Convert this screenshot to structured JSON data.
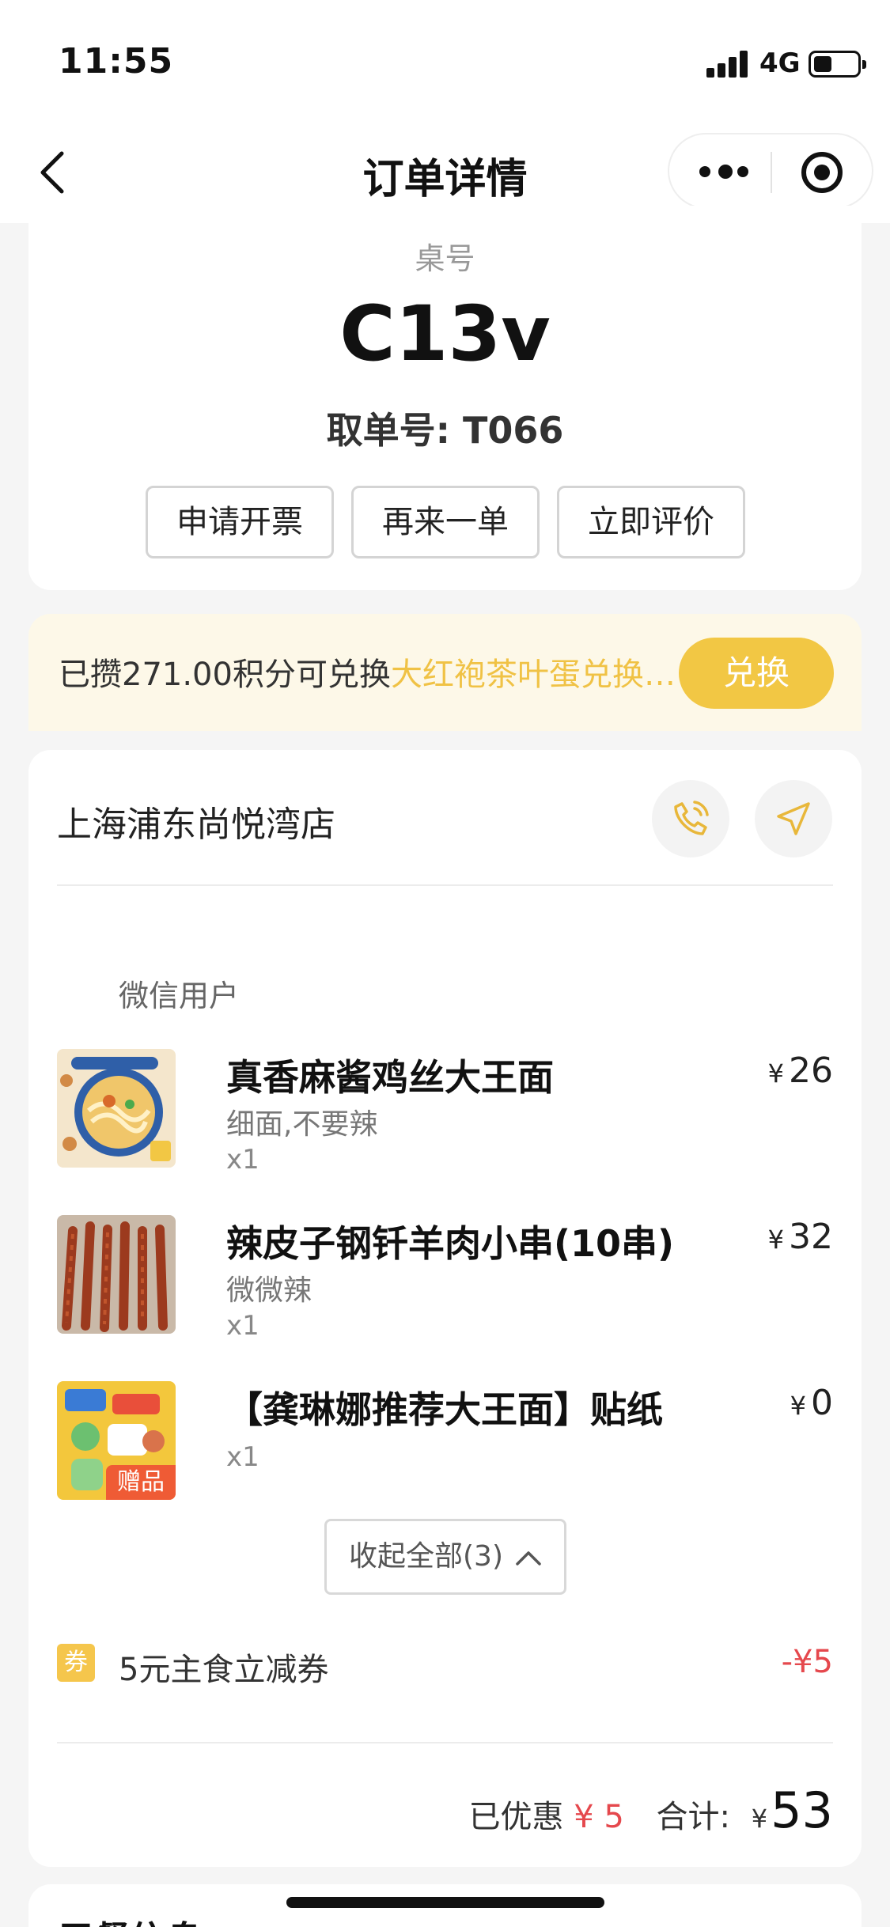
{
  "status_bar": {
    "time": "11:55",
    "network": "4G"
  },
  "nav": {
    "title": "订单详情"
  },
  "order": {
    "table_label": "桌号",
    "table_number": "C13v",
    "pickup_number": "取单号: T066",
    "actions": [
      "申请开票",
      "再来一单",
      "立即评价"
    ]
  },
  "points_banner": {
    "text": "已攒271.00积分可兑换",
    "highlight": "大红袍茶叶蛋兑换…",
    "button": "兑换",
    "accent_color": "#f2c744"
  },
  "store": {
    "name": "上海浦东尚悦湾店",
    "user_label": "微信用户",
    "items": [
      {
        "name": "真香麻酱鸡丝大王面",
        "spec": "细面,不要辣",
        "qty": "x1",
        "currency": "¥",
        "price": "26"
      },
      {
        "name": "辣皮子钢钎羊肉小串(10串)",
        "spec": "微微辣",
        "qty": "x1",
        "currency": "¥",
        "price": "32"
      },
      {
        "name": "【龚琳娜推荐大王面】贴纸",
        "spec": "",
        "qty": "x1",
        "currency": "¥",
        "price": "0",
        "tag": "赠品"
      }
    ],
    "collapse_label": "收起全部(3)",
    "coupon": {
      "icon": "券",
      "text": "5元主食立减券",
      "amount": "-¥5"
    },
    "summary": {
      "discount_label": "已优惠",
      "discount_value": "¥ 5",
      "total_label": "合计:",
      "currency": "¥",
      "total": "53"
    }
  },
  "next_section": {
    "title": "用餐信息"
  }
}
